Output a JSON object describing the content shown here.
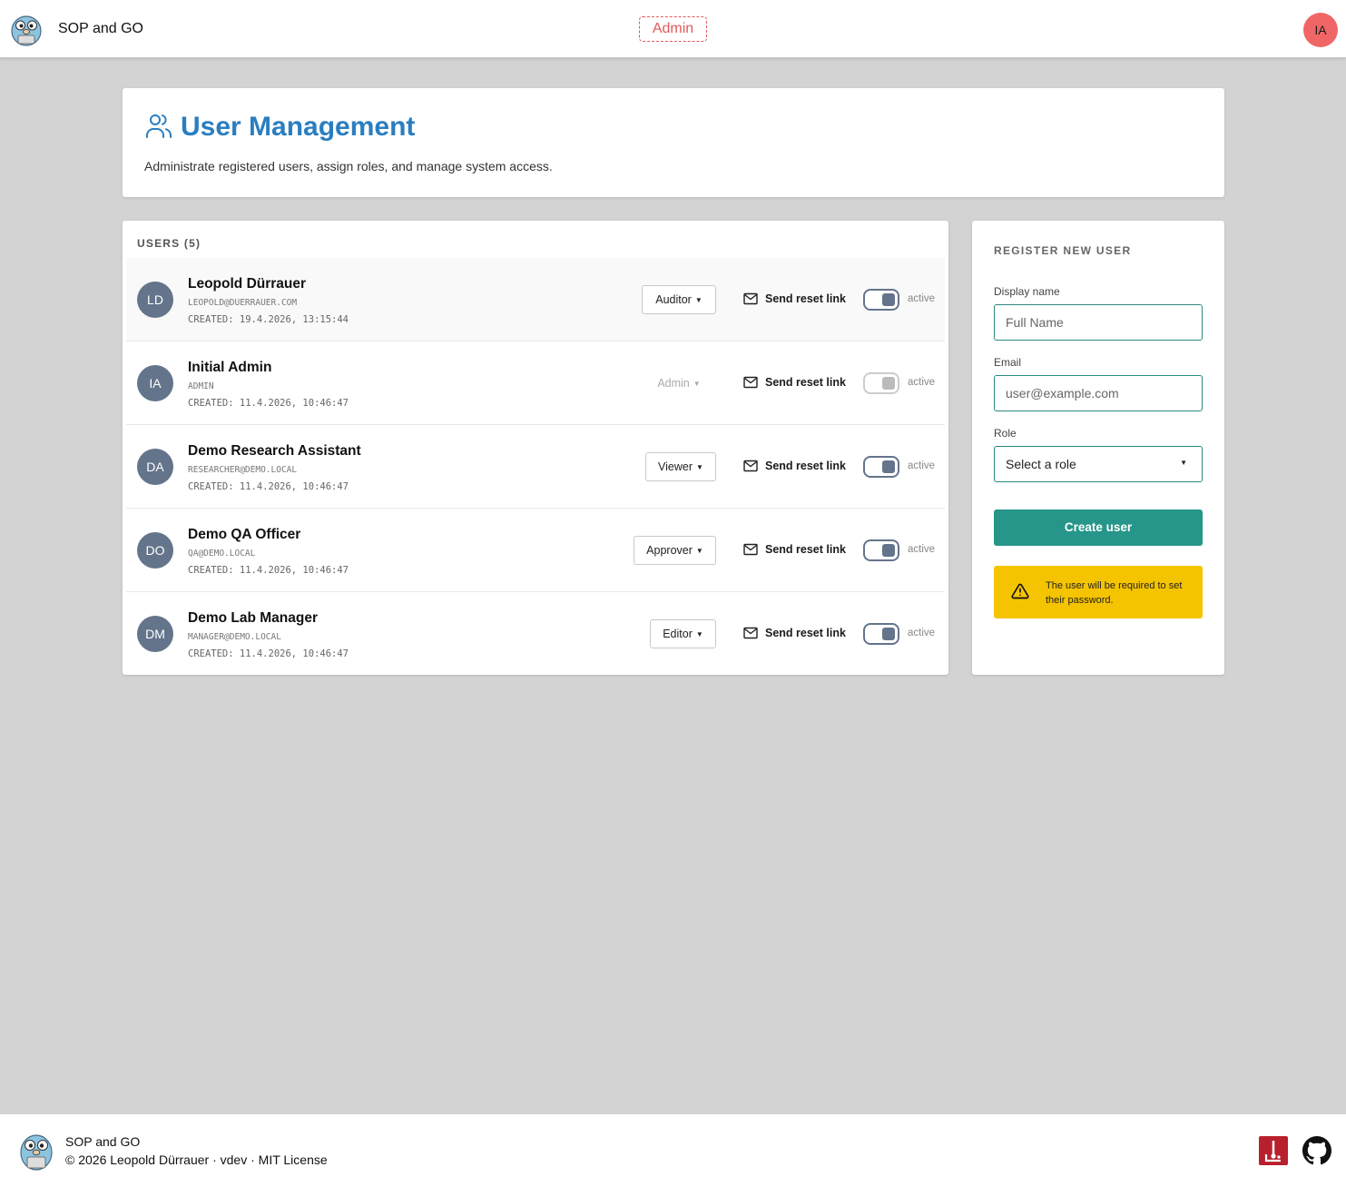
{
  "topbar": {
    "app_name": "SOP and GO",
    "admin_badge": "Admin",
    "avatar_initials": "IA",
    "logo_icon": "gopher-logo-icon"
  },
  "header": {
    "title": "User Management",
    "subtitle": "Administrate registered users, assign roles, and manage system access.",
    "icon": "users-icon",
    "title_color": "#2a7ec0"
  },
  "users": {
    "heading": "USERS (5)",
    "reset_label": "Send reset link",
    "list": [
      {
        "initials": "LD",
        "name": "Leopold Dürrauer",
        "email": "LEOPOLD@DUERRAUER.COM",
        "created": "CREATED: 19.4.2026, 13:15:44",
        "role": "Auditor",
        "status": "active",
        "role_editable": true,
        "active_toggle": true
      },
      {
        "initials": "IA",
        "name": "Initial Admin",
        "email": "ADMIN",
        "created": "CREATED: 11.4.2026, 10:46:47",
        "role": "Admin",
        "status": "active",
        "role_editable": false,
        "active_toggle": false
      },
      {
        "initials": "DA",
        "name": "Demo Research Assistant",
        "email": "RESEARCHER@DEMO.LOCAL",
        "created": "CREATED: 11.4.2026, 10:46:47",
        "role": "Viewer",
        "status": "active",
        "role_editable": true,
        "active_toggle": true
      },
      {
        "initials": "DO",
        "name": "Demo QA Officer",
        "email": "QA@DEMO.LOCAL",
        "created": "CREATED: 11.4.2026, 10:46:47",
        "role": "Approver",
        "status": "active",
        "role_editable": true,
        "active_toggle": true
      },
      {
        "initials": "DM",
        "name": "Demo Lab Manager",
        "email": "MANAGER@DEMO.LOCAL",
        "created": "CREATED: 11.4.2026, 10:46:47",
        "role": "Editor",
        "status": "active",
        "role_editable": true,
        "active_toggle": true
      }
    ]
  },
  "register": {
    "heading": "REGISTER NEW USER",
    "display_name_label": "Display name",
    "display_name_placeholder": "Full Name",
    "display_name_value": "",
    "email_label": "Email",
    "email_placeholder": "user@example.com",
    "email_value": "",
    "role_label": "Role",
    "role_value": "Select a role",
    "create_label": "Create user",
    "notice": "The user will be required to set their password.",
    "notice_icon": "warning-triangle-icon",
    "accent_color": "#26968a",
    "notice_color": "#f5c400"
  },
  "footer": {
    "app_name": "SOP and GO",
    "copyright": "© 2026 Leopold Dürrauer · vdev · MIT License",
    "doc_icon": "docs-icon",
    "github_icon": "github-icon"
  }
}
